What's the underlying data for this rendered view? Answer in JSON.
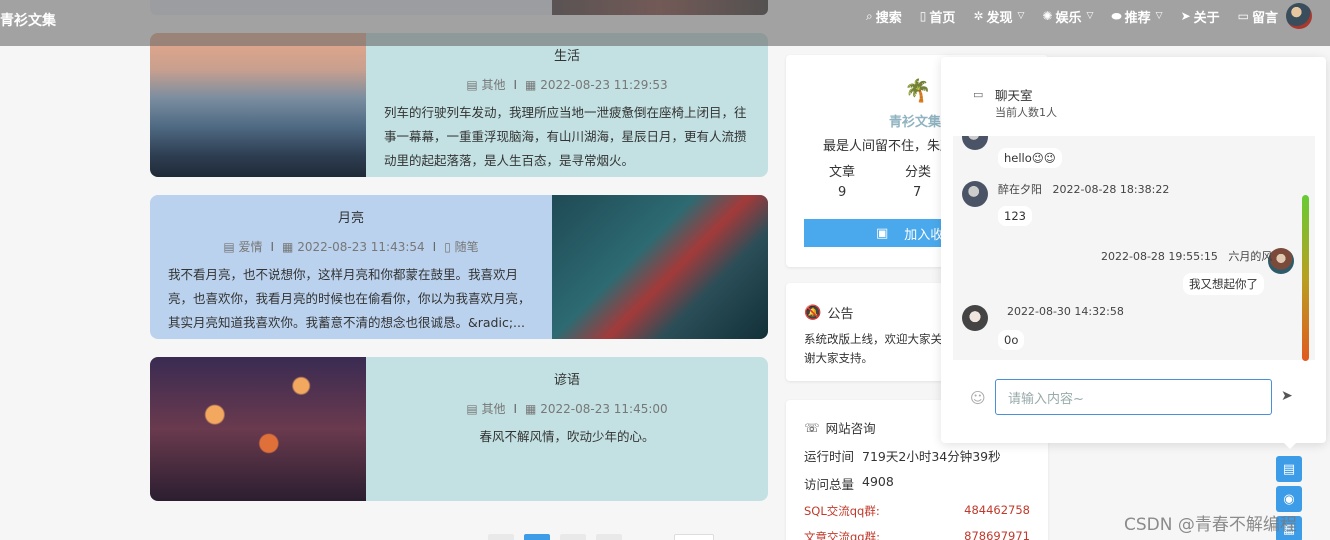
{
  "header": {
    "brand": "青衫文集",
    "nav": [
      {
        "icon": "⌕",
        "label": "搜索",
        "chevron": false
      },
      {
        "icon": "▯",
        "label": "首页",
        "chevron": false
      },
      {
        "icon": "✲",
        "label": "发现",
        "chevron": true
      },
      {
        "icon": "✺",
        "label": "娱乐",
        "chevron": true
      },
      {
        "icon": "⬬",
        "label": "推荐",
        "chevron": true
      },
      {
        "icon": "➤",
        "label": "关于",
        "chevron": false
      },
      {
        "icon": "▭",
        "label": "留言",
        "chevron": false
      }
    ]
  },
  "articles": [
    {
      "title": "生活",
      "category": "其他",
      "date": "2022-08-23 11:29:53",
      "excerpt": "列车的行驶列车发动，我理所应当地一泄疲惫倒在座椅上闭目，往事一幕幕，一重重浮现脑海，有山川湖海，星辰日月，更有人流攒动里的起起落落，是人生百态，是寻常烟火。"
    },
    {
      "title": "月亮",
      "category": "爱情",
      "date": "2022-08-23 11:43:54",
      "tag": "随笔",
      "excerpt": "我不看月亮，也不说想你，这样月亮和你都蒙在鼓里。我喜欢月亮，也喜欢你，我看月亮的时候也在偷看你，你以为我喜欢月亮，其实月亮知道我喜欢你。我蓄意不清的想念也很诚恳。&radic;..."
    },
    {
      "title": "谚语",
      "category": "其他",
      "date": "2022-08-23 11:45:00",
      "excerpt": "春风不解风情，吹动少年的心。"
    }
  ],
  "profile": {
    "name": "青衫文集",
    "motto": "最是人间留不住，朱颜",
    "stats": [
      {
        "label": "文章",
        "value": "9"
      },
      {
        "label": "分类",
        "value": "7"
      }
    ],
    "button": "加入收"
  },
  "notice": {
    "title": "公告",
    "text": "系统改版上线，欢迎大家关注，序/app，感谢大家支持。"
  },
  "site_info": {
    "title": "网站咨询",
    "runtime_label": "运行时间",
    "runtime_value": "719天2小时34分钟39秒",
    "visits_label": "访问总量",
    "visits_value": "4908",
    "sql_label": "SQL交流qq群:",
    "sql_value": "484462758",
    "article_label": "文章交流qq群:",
    "article_value": "878697971"
  },
  "chat": {
    "title": "聊天室",
    "online": "当前人数1人",
    "messages": [
      {
        "user": "",
        "time": "",
        "text": "hello😉😉"
      },
      {
        "user": "醉在夕阳",
        "time": "2022-08-28 18:38:22",
        "text": "123"
      },
      {
        "user": "六月的风",
        "time": "2022-08-28 19:55:15",
        "text": "我又想起你了"
      },
      {
        "user": "",
        "time": "2022-08-30 14:32:58",
        "text": "0o"
      }
    ],
    "placeholder": "请输入内容~"
  },
  "watermark": "CSDN @青春不解编程"
}
